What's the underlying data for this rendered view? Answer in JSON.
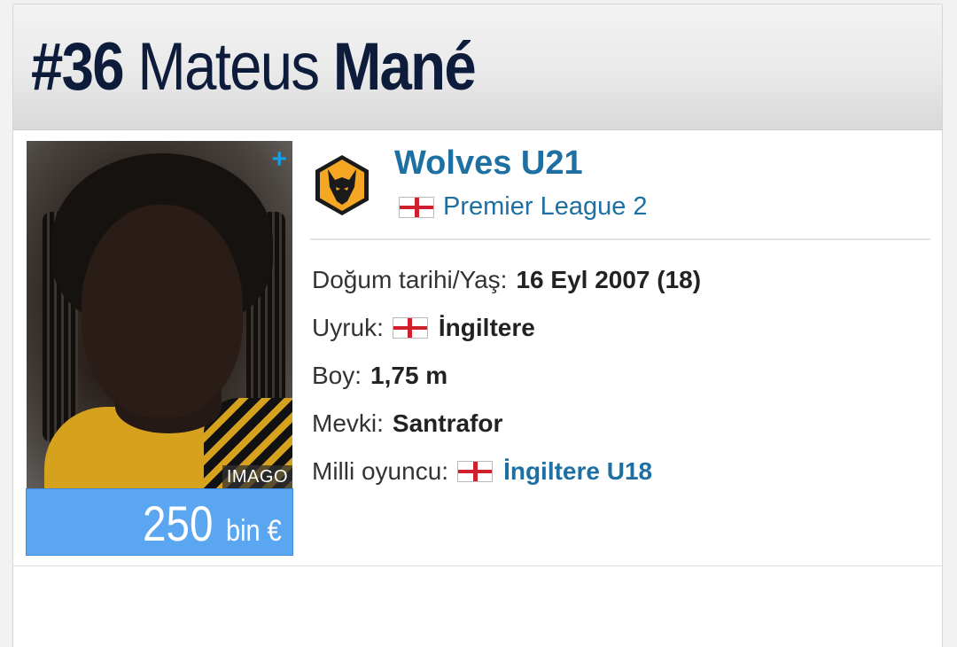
{
  "header": {
    "number": "#36",
    "first_name": "Mateus",
    "last_name": "Mané"
  },
  "photo": {
    "credit": "IMAGO",
    "add_icon": "+"
  },
  "market_value": {
    "amount": "250",
    "unit": "bin €"
  },
  "club": {
    "name": "Wolves U21",
    "league": "Premier League 2",
    "league_country_flag": "england-flag"
  },
  "details": {
    "birth": {
      "label": "Doğum tarihi/Yaş:",
      "value": "16 Eyl 2007 (18)"
    },
    "nationality": {
      "label": "Uyruk:",
      "value": "İngiltere",
      "flag": "england-flag"
    },
    "height": {
      "label": "Boy:",
      "value": "1,75 m"
    },
    "position": {
      "label": "Mevki:",
      "value": "Santrafor"
    },
    "national_team": {
      "label": "Milli oyuncu:",
      "value": "İngiltere U18",
      "flag": "england-flag"
    }
  },
  "colors": {
    "navy": "#0e1c3c",
    "link_blue": "#1e6fa2",
    "value_blue": "#5aa6f0",
    "wolves_gold": "#f5a623",
    "england_red": "#d0202e"
  }
}
